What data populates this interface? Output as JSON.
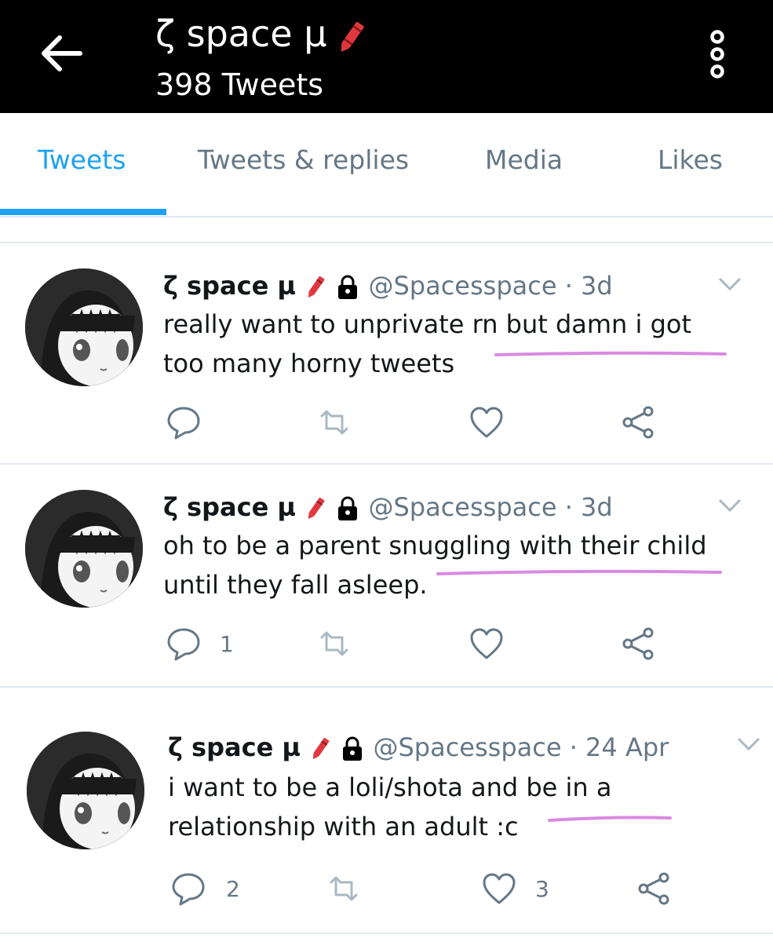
{
  "header": {
    "title": "ζ space µ",
    "subtitle": "398 Tweets"
  },
  "tabs": [
    {
      "label": "Tweets",
      "active": true
    },
    {
      "label": "Tweets & replies",
      "active": false
    },
    {
      "label": "Media",
      "active": false
    },
    {
      "label": "Likes",
      "active": false
    }
  ],
  "tweets": [
    {
      "name": "ζ space µ",
      "handle": "@Spacesspace",
      "time": "· 3d",
      "line1": "really want to unprivate rn but damn i got",
      "line2": "too many horny tweets",
      "reply_count": "",
      "like_count": ""
    },
    {
      "name": "ζ space µ",
      "handle": "@Spacesspace",
      "time": "· 3d",
      "line1": "oh to be a parent snuggling with their child",
      "line2": "until they fall asleep.",
      "reply_count": "1",
      "like_count": ""
    },
    {
      "name": "ζ space µ",
      "handle": "@Spacesspace",
      "time": "· 24 Apr",
      "line1": "i want to be a loli/shota and be in a",
      "line2": "relationship with an adult :c",
      "reply_count": "2",
      "like_count": "3"
    }
  ],
  "colors": {
    "accent": "#1da1f2",
    "muted": "#657786",
    "annotation": "#d98ae0",
    "pencil": "#e0383e"
  }
}
